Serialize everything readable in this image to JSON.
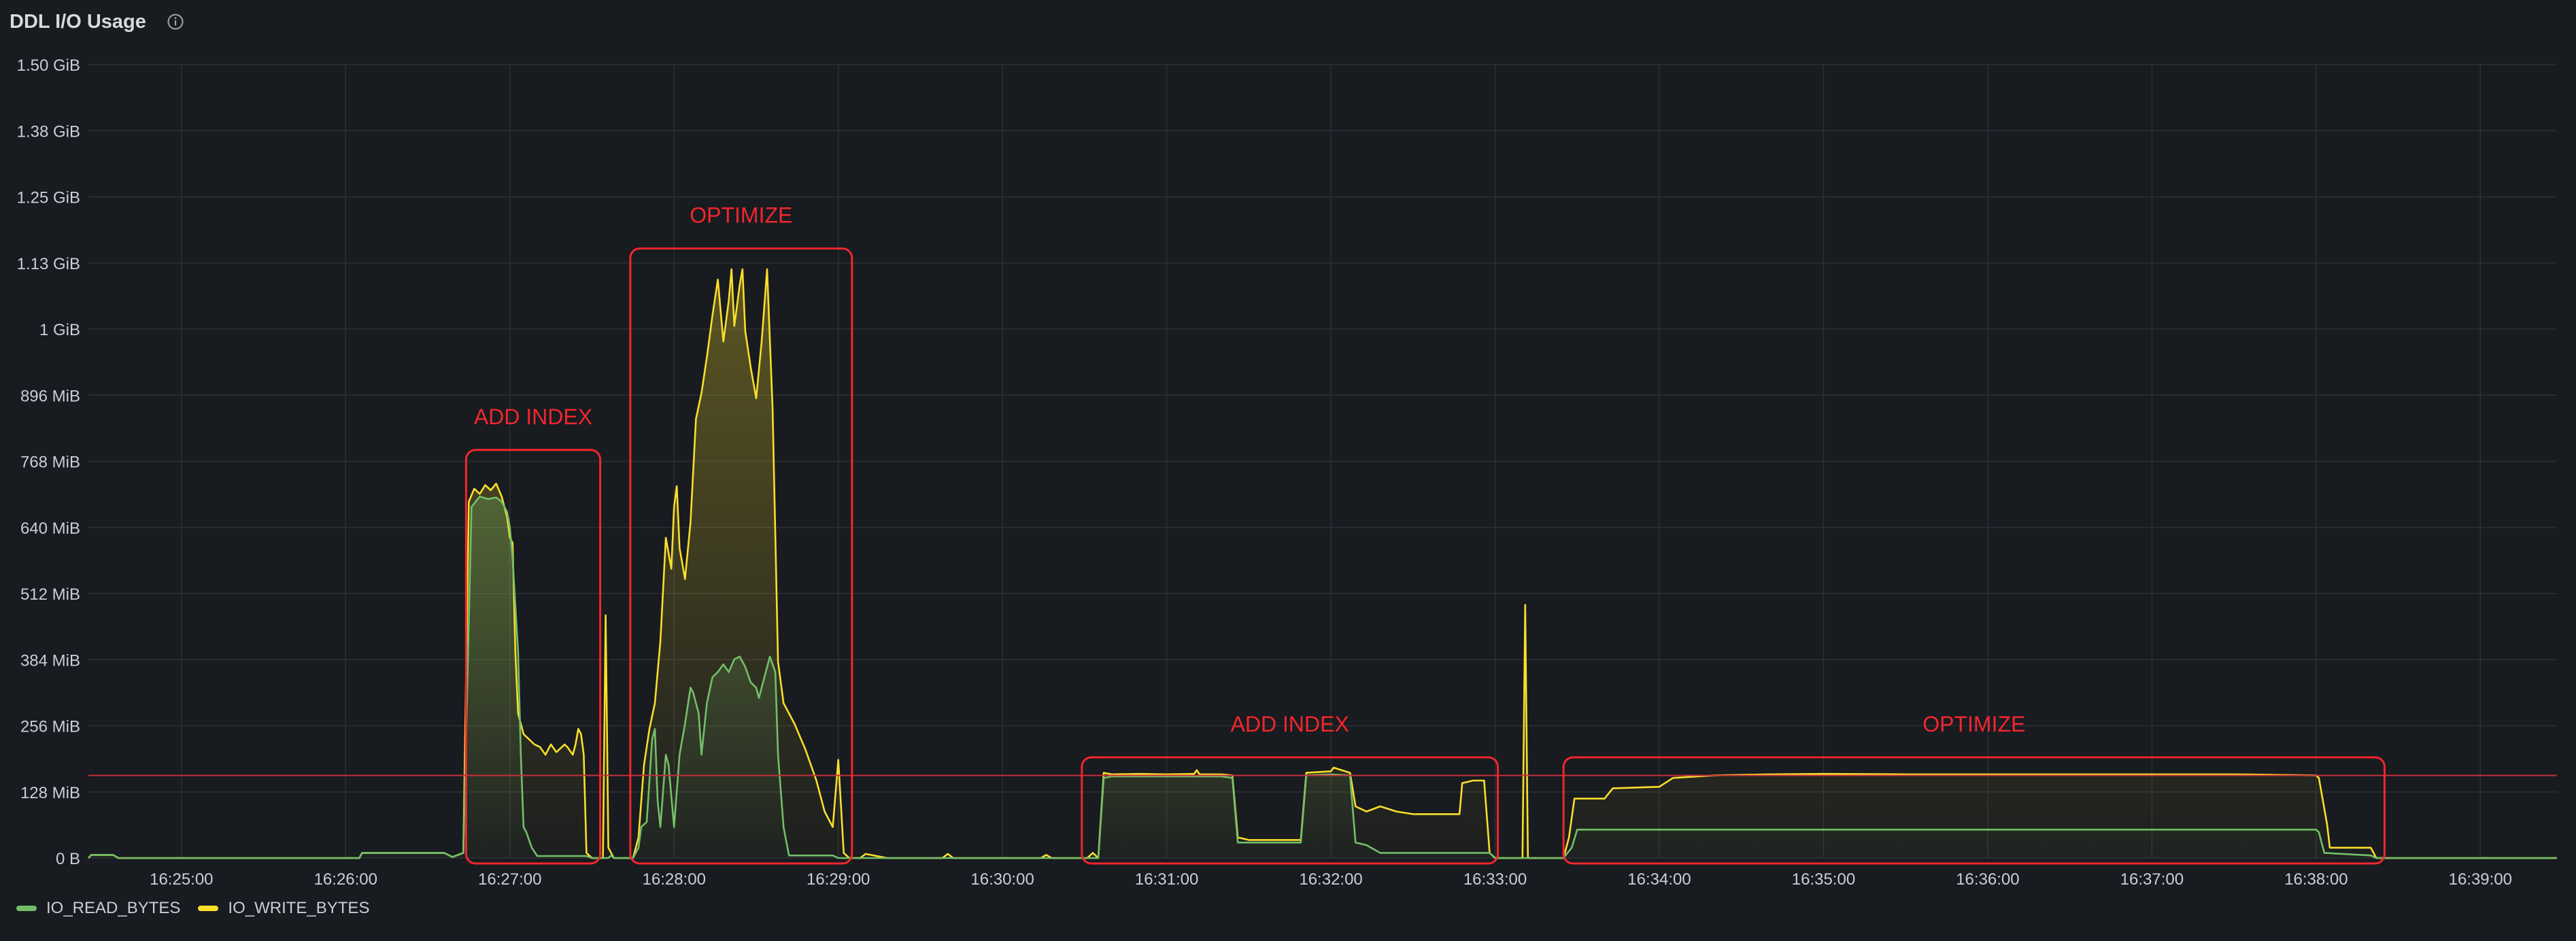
{
  "panel": {
    "title": "DDL I/O Usage",
    "info_icon": "info-circle-icon"
  },
  "chart_data": {
    "type": "line",
    "title": "DDL I/O Usage",
    "xlabel": "",
    "ylabel": "",
    "x_unit": "time",
    "y_unit": "MiB",
    "xlim": [
      "16:24:26",
      "16:39:28"
    ],
    "ylim": [
      0,
      1536
    ],
    "y_ticks": [
      {
        "value": 0,
        "label": "0 B"
      },
      {
        "value": 128,
        "label": "128 MiB"
      },
      {
        "value": 256,
        "label": "256 MiB"
      },
      {
        "value": 384,
        "label": "384 MiB"
      },
      {
        "value": 512,
        "label": "512 MiB"
      },
      {
        "value": 640,
        "label": "640 MiB"
      },
      {
        "value": 768,
        "label": "768 MiB"
      },
      {
        "value": 896,
        "label": "896 MiB"
      },
      {
        "value": 1024,
        "label": "1 GiB"
      },
      {
        "value": 1152,
        "label": "1.13 GiB"
      },
      {
        "value": 1280,
        "label": "1.25 GiB"
      },
      {
        "value": 1408,
        "label": "1.38 GiB"
      },
      {
        "value": 1536,
        "label": "1.50 GiB"
      }
    ],
    "x_ticks": [
      "16:25:00",
      "16:26:00",
      "16:27:00",
      "16:28:00",
      "16:29:00",
      "16:30:00",
      "16:31:00",
      "16:32:00",
      "16:33:00",
      "16:34:00",
      "16:35:00",
      "16:36:00",
      "16:37:00",
      "16:38:00",
      "16:39:00"
    ],
    "grid": true,
    "legend_position": "bottom-left",
    "threshold": {
      "value": 160,
      "color": "#c4313b"
    },
    "series": [
      {
        "name": "IO_READ_BYTES",
        "color": "#73bf69",
        "points": [
          [
            "16:24:26",
            0
          ],
          [
            "16:24:27",
            6
          ],
          [
            "16:24:35",
            6
          ],
          [
            "16:24:37",
            0
          ],
          [
            "16:26:05",
            0
          ],
          [
            "16:26:06",
            10
          ],
          [
            "16:26:36",
            10
          ],
          [
            "16:26:39",
            2
          ],
          [
            "16:26:43",
            10
          ],
          [
            "16:26:46",
            680
          ],
          [
            "16:26:49",
            700
          ],
          [
            "16:26:52",
            695
          ],
          [
            "16:26:55",
            698
          ],
          [
            "16:26:57",
            690
          ],
          [
            "16:26:59",
            670
          ],
          [
            "16:27:00",
            640
          ],
          [
            "16:27:01",
            580
          ],
          [
            "16:27:03",
            400
          ],
          [
            "16:27:04",
            200
          ],
          [
            "16:27:05",
            60
          ],
          [
            "16:27:06",
            50
          ],
          [
            "16:27:08",
            20
          ],
          [
            "16:27:10",
            4
          ],
          [
            "16:27:28",
            4
          ],
          [
            "16:27:30",
            0
          ],
          [
            "16:27:36",
            0
          ],
          [
            "16:27:37",
            5
          ],
          [
            "16:27:38",
            0
          ],
          [
            "16:27:45",
            0
          ],
          [
            "16:27:47",
            20
          ],
          [
            "16:27:48",
            60
          ],
          [
            "16:27:50",
            70
          ],
          [
            "16:27:52",
            230
          ],
          [
            "16:27:53",
            250
          ],
          [
            "16:27:54",
            110
          ],
          [
            "16:27:55",
            60
          ],
          [
            "16:27:57",
            200
          ],
          [
            "16:27:58",
            180
          ],
          [
            "16:28:00",
            60
          ],
          [
            "16:28:02",
            200
          ],
          [
            "16:28:04",
            260
          ],
          [
            "16:28:06",
            330
          ],
          [
            "16:28:07",
            320
          ],
          [
            "16:28:09",
            280
          ],
          [
            "16:28:10",
            200
          ],
          [
            "16:28:12",
            300
          ],
          [
            "16:28:14",
            350
          ],
          [
            "16:28:16",
            360
          ],
          [
            "16:28:18",
            375
          ],
          [
            "16:28:20",
            360
          ],
          [
            "16:28:22",
            385
          ],
          [
            "16:28:24",
            390
          ],
          [
            "16:28:26",
            370
          ],
          [
            "16:28:28",
            340
          ],
          [
            "16:28:30",
            330
          ],
          [
            "16:28:31",
            310
          ],
          [
            "16:28:33",
            350
          ],
          [
            "16:28:35",
            390
          ],
          [
            "16:28:37",
            360
          ],
          [
            "16:28:38",
            200
          ],
          [
            "16:28:40",
            60
          ],
          [
            "16:28:42",
            5
          ],
          [
            "16:28:58",
            5
          ],
          [
            "16:29:00",
            0
          ],
          [
            "16:30:31",
            0
          ],
          [
            "16:30:35",
            0
          ],
          [
            "16:30:37",
            155
          ],
          [
            "16:30:40",
            158
          ],
          [
            "16:30:50",
            158
          ],
          [
            "16:31:00",
            158
          ],
          [
            "16:31:10",
            158
          ],
          [
            "16:31:20",
            158
          ],
          [
            "16:31:24",
            155
          ],
          [
            "16:31:26",
            30
          ],
          [
            "16:31:30",
            30
          ],
          [
            "16:31:40",
            30
          ],
          [
            "16:31:49",
            30
          ],
          [
            "16:31:51",
            160
          ],
          [
            "16:32:00",
            162
          ],
          [
            "16:32:07",
            160
          ],
          [
            "16:32:09",
            30
          ],
          [
            "16:32:13",
            25
          ],
          [
            "16:32:18",
            10
          ],
          [
            "16:32:30",
            10
          ],
          [
            "16:32:50",
            10
          ],
          [
            "16:32:58",
            10
          ],
          [
            "16:33:00",
            0
          ],
          [
            "16:33:25",
            0
          ],
          [
            "16:33:28",
            20
          ],
          [
            "16:33:30",
            55
          ],
          [
            "16:34:00",
            55
          ],
          [
            "16:34:30",
            55
          ],
          [
            "16:35:00",
            55
          ],
          [
            "16:35:30",
            55
          ],
          [
            "16:36:00",
            55
          ],
          [
            "16:36:30",
            55
          ],
          [
            "16:37:00",
            55
          ],
          [
            "16:37:30",
            55
          ],
          [
            "16:38:00",
            55
          ],
          [
            "16:38:01",
            50
          ],
          [
            "16:38:03",
            10
          ],
          [
            "16:38:20",
            5
          ],
          [
            "16:38:22",
            0
          ],
          [
            "16:39:28",
            0
          ]
        ]
      },
      {
        "name": "IO_WRITE_BYTES",
        "color": "#fade2a",
        "points": [
          [
            "16:24:26",
            0
          ],
          [
            "16:24:27",
            6
          ],
          [
            "16:24:35",
            6
          ],
          [
            "16:24:37",
            0
          ],
          [
            "16:26:05",
            0
          ],
          [
            "16:26:06",
            10
          ],
          [
            "16:26:36",
            10
          ],
          [
            "16:26:39",
            2
          ],
          [
            "16:26:43",
            10
          ],
          [
            "16:26:45",
            690
          ],
          [
            "16:26:47",
            715
          ],
          [
            "16:26:49",
            705
          ],
          [
            "16:26:51",
            722
          ],
          [
            "16:26:53",
            712
          ],
          [
            "16:26:55",
            725
          ],
          [
            "16:26:57",
            700
          ],
          [
            "16:26:58",
            680
          ],
          [
            "16:26:59",
            660
          ],
          [
            "16:27:00",
            620
          ],
          [
            "16:27:01",
            610
          ],
          [
            "16:27:02",
            400
          ],
          [
            "16:27:03",
            280
          ],
          [
            "16:27:05",
            240
          ],
          [
            "16:27:07",
            230
          ],
          [
            "16:27:09",
            220
          ],
          [
            "16:27:11",
            215
          ],
          [
            "16:27:13",
            200
          ],
          [
            "16:27:15",
            220
          ],
          [
            "16:27:17",
            205
          ],
          [
            "16:27:19",
            215
          ],
          [
            "16:27:20",
            220
          ],
          [
            "16:27:21",
            215
          ],
          [
            "16:27:23",
            200
          ],
          [
            "16:27:24",
            220
          ],
          [
            "16:27:25",
            250
          ],
          [
            "16:27:26",
            240
          ],
          [
            "16:27:27",
            200
          ],
          [
            "16:27:28",
            10
          ],
          [
            "16:27:30",
            0
          ],
          [
            "16:27:34",
            0
          ],
          [
            "16:27:35",
            470
          ],
          [
            "16:27:36",
            20
          ],
          [
            "16:27:38",
            0
          ],
          [
            "16:27:45",
            0
          ],
          [
            "16:27:47",
            40
          ],
          [
            "16:27:49",
            180
          ],
          [
            "16:27:51",
            250
          ],
          [
            "16:27:53",
            300
          ],
          [
            "16:27:55",
            420
          ],
          [
            "16:27:57",
            620
          ],
          [
            "16:27:59",
            560
          ],
          [
            "16:28:00",
            680
          ],
          [
            "16:28:01",
            720
          ],
          [
            "16:28:02",
            600
          ],
          [
            "16:28:04",
            540
          ],
          [
            "16:28:06",
            650
          ],
          [
            "16:28:08",
            850
          ],
          [
            "16:28:10",
            900
          ],
          [
            "16:28:12",
            970
          ],
          [
            "16:28:14",
            1050
          ],
          [
            "16:28:16",
            1120
          ],
          [
            "16:28:18",
            1000
          ],
          [
            "16:28:20",
            1080
          ],
          [
            "16:28:21",
            1140
          ],
          [
            "16:28:22",
            1030
          ],
          [
            "16:28:24",
            1110
          ],
          [
            "16:28:25",
            1140
          ],
          [
            "16:28:26",
            1020
          ],
          [
            "16:28:28",
            950
          ],
          [
            "16:28:30",
            890
          ],
          [
            "16:28:32",
            1000
          ],
          [
            "16:28:34",
            1140
          ],
          [
            "16:28:36",
            870
          ],
          [
            "16:28:38",
            380
          ],
          [
            "16:28:40",
            300
          ],
          [
            "16:28:44",
            260
          ],
          [
            "16:28:48",
            210
          ],
          [
            "16:28:52",
            150
          ],
          [
            "16:28:55",
            90
          ],
          [
            "16:28:58",
            60
          ],
          [
            "16:29:00",
            190
          ],
          [
            "16:29:02",
            10
          ],
          [
            "16:29:04",
            0
          ],
          [
            "16:29:08",
            0
          ],
          [
            "16:29:10",
            8
          ],
          [
            "16:29:14",
            4
          ],
          [
            "16:29:18",
            0
          ],
          [
            "16:29:38",
            0
          ],
          [
            "16:29:40",
            8
          ],
          [
            "16:29:42",
            0
          ],
          [
            "16:30:14",
            0
          ],
          [
            "16:30:16",
            6
          ],
          [
            "16:30:18",
            0
          ],
          [
            "16:30:31",
            0
          ],
          [
            "16:30:33",
            10
          ],
          [
            "16:30:35",
            0
          ],
          [
            "16:30:37",
            165
          ],
          [
            "16:30:40",
            162
          ],
          [
            "16:30:50",
            163
          ],
          [
            "16:31:00",
            162
          ],
          [
            "16:31:10",
            163
          ],
          [
            "16:31:11",
            170
          ],
          [
            "16:31:12",
            162
          ],
          [
            "16:31:20",
            162
          ],
          [
            "16:31:24",
            160
          ],
          [
            "16:31:26",
            40
          ],
          [
            "16:31:30",
            35
          ],
          [
            "16:31:40",
            35
          ],
          [
            "16:31:49",
            35
          ],
          [
            "16:31:51",
            165
          ],
          [
            "16:32:00",
            168
          ],
          [
            "16:32:01",
            175
          ],
          [
            "16:32:07",
            165
          ],
          [
            "16:32:09",
            100
          ],
          [
            "16:32:13",
            90
          ],
          [
            "16:32:18",
            100
          ],
          [
            "16:32:24",
            90
          ],
          [
            "16:32:30",
            85
          ],
          [
            "16:32:40",
            85
          ],
          [
            "16:32:47",
            85
          ],
          [
            "16:32:48",
            145
          ],
          [
            "16:32:52",
            150
          ],
          [
            "16:32:56",
            150
          ],
          [
            "16:32:58",
            10
          ],
          [
            "16:33:00",
            0
          ],
          [
            "16:33:10",
            0
          ],
          [
            "16:33:11",
            490
          ],
          [
            "16:33:12",
            0
          ],
          [
            "16:33:13",
            0
          ],
          [
            "16:33:25",
            0
          ],
          [
            "16:33:27",
            40
          ],
          [
            "16:33:29",
            115
          ],
          [
            "16:33:40",
            115
          ],
          [
            "16:33:43",
            135
          ],
          [
            "16:34:00",
            138
          ],
          [
            "16:34:05",
            155
          ],
          [
            "16:34:20",
            160
          ],
          [
            "16:34:40",
            162
          ],
          [
            "16:35:00",
            163
          ],
          [
            "16:35:30",
            162
          ],
          [
            "16:36:00",
            162
          ],
          [
            "16:36:30",
            162
          ],
          [
            "16:37:00",
            162
          ],
          [
            "16:37:30",
            162
          ],
          [
            "16:38:00",
            160
          ],
          [
            "16:38:01",
            155
          ],
          [
            "16:38:04",
            65
          ],
          [
            "16:38:05",
            20
          ],
          [
            "16:38:20",
            20
          ],
          [
            "16:38:22",
            0
          ],
          [
            "16:39:28",
            0
          ]
        ]
      }
    ],
    "annotations": [
      {
        "label": "ADD INDEX",
        "x_start": "16:26:44",
        "x_end": "16:27:33",
        "y_top": 790,
        "color": "#f2262e"
      },
      {
        "label": "OPTIMIZE",
        "x_start": "16:27:44",
        "x_end": "16:29:05",
        "y_top": 1180,
        "color": "#f2262e"
      },
      {
        "label": "ADD INDEX",
        "x_start": "16:30:29",
        "x_end": "16:33:01",
        "y_top": 195,
        "color": "#f2262e"
      },
      {
        "label": "OPTIMIZE",
        "x_start": "16:33:25",
        "x_end": "16:38:25",
        "y_top": 195,
        "color": "#f2262e"
      }
    ]
  }
}
